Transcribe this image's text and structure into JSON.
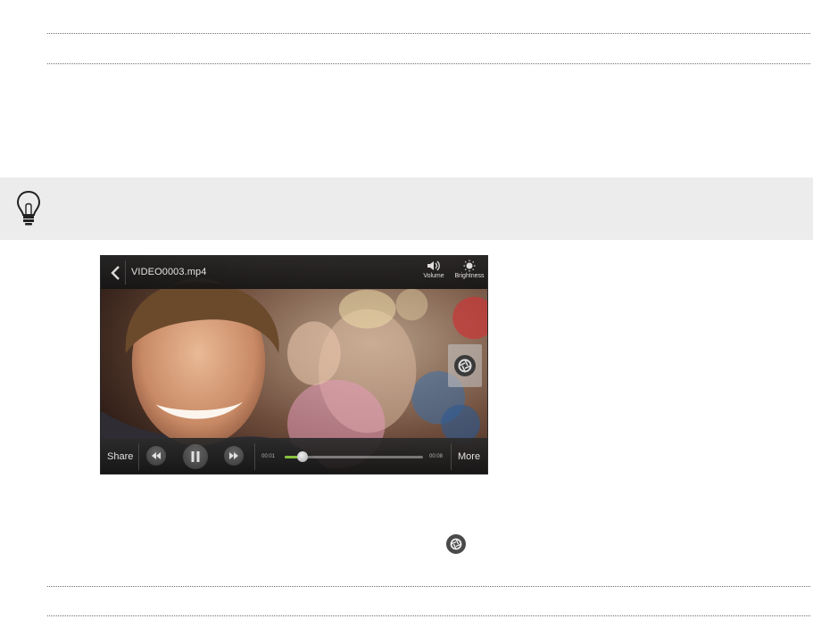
{
  "player": {
    "file_title": "VIDEO0003.mp4",
    "volume_label": "Volume",
    "brightness_label": "Brightness",
    "share_label": "Share",
    "more_label": "More",
    "elapsed_time": "00:01",
    "total_time": "00:08",
    "progress_fraction": 0.13
  },
  "icons": {
    "tip": "lightbulb-icon",
    "back": "back-arrow-icon",
    "volume": "speaker-icon",
    "brightness": "brightness-icon",
    "capture": "camera-shutter-icon",
    "rewind": "rewind-icon",
    "pause": "pause-icon",
    "forward": "fast-forward-icon"
  },
  "colors": {
    "tip_band": "#ececec",
    "progress": "#8fcf3f"
  }
}
